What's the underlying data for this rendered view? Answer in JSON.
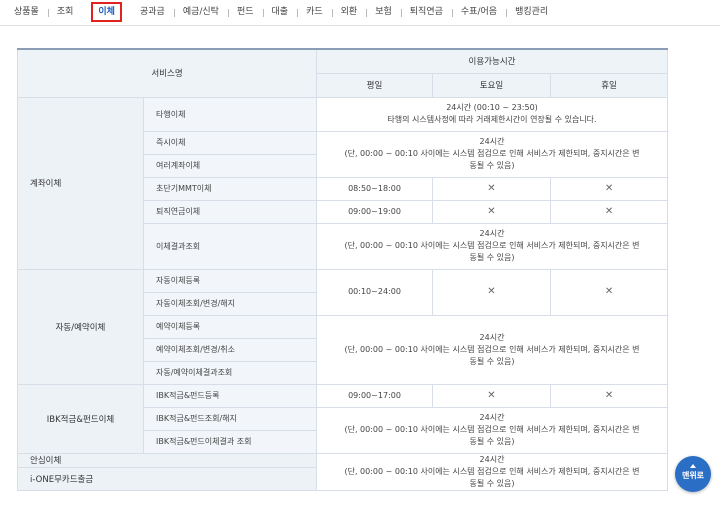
{
  "tabs": [
    {
      "label": "상품몰",
      "active": false
    },
    {
      "label": "조회",
      "active": false
    },
    {
      "label": "이체",
      "active": true
    },
    {
      "label": "공과금",
      "active": false
    },
    {
      "label": "예금/신탁",
      "active": false
    },
    {
      "label": "펀드",
      "active": false
    },
    {
      "label": "대출",
      "active": false
    },
    {
      "label": "카드",
      "active": false
    },
    {
      "label": "외환",
      "active": false
    },
    {
      "label": "보험",
      "active": false
    },
    {
      "label": "퇴직연금",
      "active": false
    },
    {
      "label": "수표/어음",
      "active": false
    },
    {
      "label": "뱅킹관리",
      "active": false
    }
  ],
  "table": {
    "header": {
      "service": "서비스명",
      "availability": "이용가능시간",
      "weekday": "평일",
      "saturday": "토요일",
      "holiday": "휴일"
    },
    "groups": {
      "account_transfer": "계좌이체",
      "auto_reserved": "자동/예약이체",
      "ibk_savings": "IBK적금&펀드이체",
      "safe_transfer": "안심이체",
      "ione_cardless": "i-ONE무카드출금"
    },
    "rows": {
      "other_bank": "타행이체",
      "instant": "즉시이체",
      "multi_account": "여러계좌이체",
      "ultra_mmt": "초단기MMT이체",
      "pension": "퇴직연금이체",
      "transfer_result": "이체결과조회",
      "auto_register": "자동이체등록",
      "auto_manage": "자동이체조회/변경/해지",
      "reserve_register": "예약이체등록",
      "reserve_manage": "예약이체조회/변경/취소",
      "auto_reserve_result": "자동/예약이체결과조회",
      "ibk_register": "IBK적금&펀드등록",
      "ibk_manage": "IBK적금&펀드조회/해지",
      "ibk_result": "IBK적금&펀드이체결과 조회"
    },
    "text": {
      "h24": "24시간",
      "other_bank_range": "24시간 (00:10 ~ 23:50)",
      "other_bank_note": "타행의 시스템사정에 따라 거래제한시간이 연장될 수 있습니다.",
      "maint_line1": "(단, 00:00 ~ 00:10 사이에는 시스템 점검으로 인해 서비스가 제한되며, 중지시간은 변",
      "maint_line2": "동될 수 있음)",
      "mmt_weekday": "08:50~18:00",
      "pension_weekday": "09:00~19:00",
      "auto_weekday": "00:10~24:00",
      "ibk_weekday": "09:00~17:00",
      "unavailable": "✕"
    }
  },
  "top_button": {
    "label": "맨위로"
  }
}
